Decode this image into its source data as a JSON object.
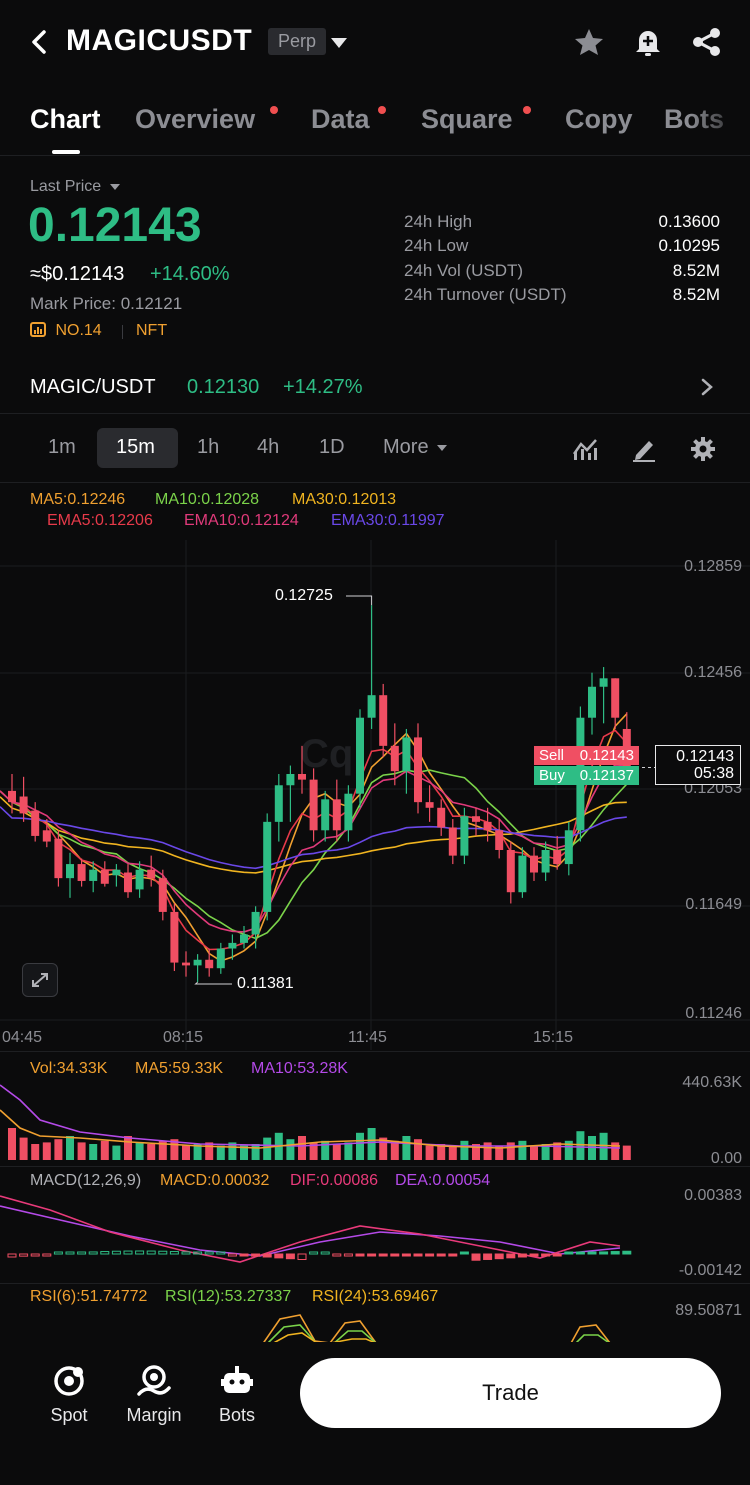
{
  "header": {
    "symbol": "MAGICUSDT",
    "contract_type": "Perp"
  },
  "tabs": [
    {
      "label": "Chart",
      "active": true,
      "dot": false
    },
    {
      "label": "Overview",
      "active": false,
      "dot": true
    },
    {
      "label": "Data",
      "active": false,
      "dot": true
    },
    {
      "label": "Square",
      "active": false,
      "dot": true
    },
    {
      "label": "Copy",
      "active": false,
      "dot": false
    },
    {
      "label": "Bots",
      "active": false,
      "dot": false
    }
  ],
  "price": {
    "last_price_label": "Last Price",
    "last_price": "0.12143",
    "usd_price": "≈$0.12143",
    "change_pct": "+14.60%",
    "mark_price_label": "Mark Price:",
    "mark_price": "0.12121",
    "rank": "NO.14",
    "category": "NFT"
  },
  "stats": [
    {
      "label": "24h High",
      "value": "0.13600"
    },
    {
      "label": "24h Low",
      "value": "0.10295"
    },
    {
      "label": "24h Vol (USDT)",
      "value": "8.52M"
    },
    {
      "label": "24h Turnover (USDT)",
      "value": "8.52M"
    }
  ],
  "spot_row": {
    "pair": "MAGIC/USDT",
    "price": "0.12130",
    "change": "+14.27%"
  },
  "intervals": [
    "1m",
    "15m",
    "1h",
    "4h",
    "1D",
    "More"
  ],
  "active_interval": "15m",
  "indicators": {
    "ma5": "MA5:0.12246",
    "ma10": "MA10:0.12028",
    "ma30": "MA30:0.12013",
    "ema5": "EMA5:0.12206",
    "ema10": "EMA10:0.12124",
    "ema30": "EMA30:0.11997"
  },
  "price_axis": [
    "0.12859",
    "0.12456",
    "0.12053",
    "0.11649",
    "0.11246"
  ],
  "time_axis": [
    "04:45",
    "08:15",
    "11:45",
    "15:15"
  ],
  "annotations": {
    "high": "0.12725",
    "low": "0.11381",
    "sell_label": "Sell",
    "sell_price": "0.12143",
    "buy_label": "Buy",
    "buy_price": "0.12137",
    "current_price": "0.12143",
    "countdown": "05:38"
  },
  "volume": {
    "vol": "Vol:34.33K",
    "ma5": "MA5:59.33K",
    "ma10": "MA10:53.28K",
    "axis_top": "440.63K",
    "axis_bottom": "0.00"
  },
  "macd": {
    "title": "MACD(12,26,9)",
    "macd": "MACD:0.00032",
    "dif": "DIF:0.00086",
    "dea": "DEA:0.00054",
    "axis_top": "0.00383",
    "axis_bottom": "-0.00142"
  },
  "rsi": {
    "rsi6": "RSI(6):51.74772",
    "rsi12": "RSI(12):53.27337",
    "rsi24": "RSI(24):53.69467",
    "axis_top": "89.50871"
  },
  "bottom_nav": [
    {
      "label": "Spot",
      "icon": "spot-icon"
    },
    {
      "label": "Margin",
      "icon": "margin-icon"
    },
    {
      "label": "Bots",
      "icon": "bots-icon"
    }
  ],
  "trade_button": "Trade",
  "colors": {
    "up": "#2ebd85",
    "down": "#f04f63",
    "ma5": "#f0a030",
    "ma10": "#7bd34a",
    "ma30": "#f0b420",
    "ema5": "#e83a4a",
    "ema10": "#e03a7a",
    "ema30": "#6a48e8"
  },
  "chart_data": {
    "type": "candlestick",
    "candles": [
      {
        "o": 0.1206,
        "h": 0.1212,
        "l": 0.1198,
        "c": 0.1202
      },
      {
        "o": 0.1204,
        "h": 0.1211,
        "l": 0.1195,
        "c": 0.1198
      },
      {
        "o": 0.1199,
        "h": 0.1202,
        "l": 0.1188,
        "c": 0.119
      },
      {
        "o": 0.1192,
        "h": 0.1196,
        "l": 0.1186,
        "c": 0.1188
      },
      {
        "o": 0.1189,
        "h": 0.1192,
        "l": 0.1172,
        "c": 0.1175
      },
      {
        "o": 0.1175,
        "h": 0.1184,
        "l": 0.1168,
        "c": 0.118
      },
      {
        "o": 0.118,
        "h": 0.1182,
        "l": 0.1172,
        "c": 0.1174
      },
      {
        "o": 0.1174,
        "h": 0.1181,
        "l": 0.117,
        "c": 0.1178
      },
      {
        "o": 0.1178,
        "h": 0.1181,
        "l": 0.1172,
        "c": 0.1173
      },
      {
        "o": 0.1176,
        "h": 0.118,
        "l": 0.1172,
        "c": 0.1178
      },
      {
        "o": 0.1177,
        "h": 0.118,
        "l": 0.1168,
        "c": 0.117
      },
      {
        "o": 0.1171,
        "h": 0.1181,
        "l": 0.1168,
        "c": 0.1178
      },
      {
        "o": 0.1178,
        "h": 0.1183,
        "l": 0.1172,
        "c": 0.1175
      },
      {
        "o": 0.1175,
        "h": 0.1178,
        "l": 0.116,
        "c": 0.1163
      },
      {
        "o": 0.1163,
        "h": 0.1166,
        "l": 0.1142,
        "c": 0.1145
      },
      {
        "o": 0.1145,
        "h": 0.1149,
        "l": 0.114,
        "c": 0.1144
      },
      {
        "o": 0.1144,
        "h": 0.1148,
        "l": 0.1138,
        "c": 0.1146
      },
      {
        "o": 0.1146,
        "h": 0.115,
        "l": 0.114,
        "c": 0.1143
      },
      {
        "o": 0.1143,
        "h": 0.1152,
        "l": 0.1141,
        "c": 0.115
      },
      {
        "o": 0.115,
        "h": 0.1155,
        "l": 0.1146,
        "c": 0.1152
      },
      {
        "o": 0.1152,
        "h": 0.1158,
        "l": 0.115,
        "c": 0.1155
      },
      {
        "o": 0.1155,
        "h": 0.1165,
        "l": 0.115,
        "c": 0.1163
      },
      {
        "o": 0.1163,
        "h": 0.1198,
        "l": 0.116,
        "c": 0.1195
      },
      {
        "o": 0.1195,
        "h": 0.1212,
        "l": 0.1188,
        "c": 0.1208
      },
      {
        "o": 0.1208,
        "h": 0.1215,
        "l": 0.1195,
        "c": 0.1212
      },
      {
        "o": 0.1212,
        "h": 0.1222,
        "l": 0.1205,
        "c": 0.121
      },
      {
        "o": 0.121,
        "h": 0.1214,
        "l": 0.1188,
        "c": 0.1192
      },
      {
        "o": 0.1192,
        "h": 0.1206,
        "l": 0.1188,
        "c": 0.1203
      },
      {
        "o": 0.1203,
        "h": 0.121,
        "l": 0.1188,
        "c": 0.1192
      },
      {
        "o": 0.1192,
        "h": 0.1208,
        "l": 0.1188,
        "c": 0.1205
      },
      {
        "o": 0.1205,
        "h": 0.1235,
        "l": 0.12,
        "c": 0.1232
      },
      {
        "o": 0.1232,
        "h": 0.1272,
        "l": 0.1228,
        "c": 0.124
      },
      {
        "o": 0.124,
        "h": 0.1244,
        "l": 0.1218,
        "c": 0.1222
      },
      {
        "o": 0.1222,
        "h": 0.123,
        "l": 0.1208,
        "c": 0.1213
      },
      {
        "o": 0.1213,
        "h": 0.1228,
        "l": 0.1205,
        "c": 0.1225
      },
      {
        "o": 0.1225,
        "h": 0.123,
        "l": 0.1198,
        "c": 0.1202
      },
      {
        "o": 0.1202,
        "h": 0.1208,
        "l": 0.1195,
        "c": 0.12
      },
      {
        "o": 0.12,
        "h": 0.1203,
        "l": 0.119,
        "c": 0.1193
      },
      {
        "o": 0.1193,
        "h": 0.1196,
        "l": 0.118,
        "c": 0.1183
      },
      {
        "o": 0.1183,
        "h": 0.12,
        "l": 0.118,
        "c": 0.1197
      },
      {
        "o": 0.1197,
        "h": 0.12,
        "l": 0.119,
        "c": 0.1195
      },
      {
        "o": 0.1195,
        "h": 0.12,
        "l": 0.1188,
        "c": 0.1192
      },
      {
        "o": 0.1192,
        "h": 0.1196,
        "l": 0.1182,
        "c": 0.1185
      },
      {
        "o": 0.1185,
        "h": 0.1188,
        "l": 0.1166,
        "c": 0.117
      },
      {
        "o": 0.117,
        "h": 0.1186,
        "l": 0.1168,
        "c": 0.1183
      },
      {
        "o": 0.1183,
        "h": 0.1186,
        "l": 0.1174,
        "c": 0.1177
      },
      {
        "o": 0.1177,
        "h": 0.1188,
        "l": 0.1174,
        "c": 0.1185
      },
      {
        "o": 0.1185,
        "h": 0.119,
        "l": 0.1178,
        "c": 0.118
      },
      {
        "o": 0.118,
        "h": 0.1195,
        "l": 0.1176,
        "c": 0.1192
      },
      {
        "o": 0.1192,
        "h": 0.1236,
        "l": 0.1188,
        "c": 0.1232
      },
      {
        "o": 0.1232,
        "h": 0.1248,
        "l": 0.1226,
        "c": 0.1243
      },
      {
        "o": 0.1243,
        "h": 0.125,
        "l": 0.123,
        "c": 0.1246
      },
      {
        "o": 0.1246,
        "h": 0.1246,
        "l": 0.1228,
        "c": 0.1232
      },
      {
        "o": 0.1228,
        "h": 0.1234,
        "l": 0.1212,
        "c": 0.1214
      }
    ]
  }
}
